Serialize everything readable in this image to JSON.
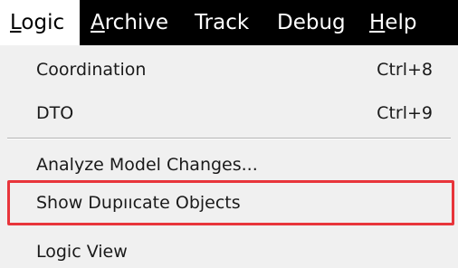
{
  "menubar": {
    "items": [
      {
        "mnemonic": "L",
        "rest": "ogic",
        "active": true
      },
      {
        "mnemonic": "A",
        "rest": "rchive",
        "active": false
      },
      {
        "mnemonic": "",
        "rest": "Track",
        "active": false
      },
      {
        "mnemonic": "",
        "rest": "Debug",
        "active": false
      },
      {
        "mnemonic": "H",
        "rest": "elp",
        "active": false
      }
    ]
  },
  "dropdown": {
    "items": [
      {
        "label": "Coordination",
        "shortcut": "Ctrl+8"
      },
      {
        "label": "DTO",
        "shortcut": "Ctrl+9"
      },
      {
        "label": "Analyze Model Changes...",
        "shortcut": ""
      },
      {
        "label": "Show Dupııcate Objects",
        "shortcut": "",
        "highlighted": true
      },
      {
        "label": "Logic View",
        "shortcut": ""
      }
    ]
  },
  "colors": {
    "menubar_bg": "#000000",
    "menubar_text": "#ffffff",
    "active_menu_bg": "#ffffff",
    "dropdown_bg": "#f0f0f0",
    "highlight_border": "#e8353b"
  }
}
